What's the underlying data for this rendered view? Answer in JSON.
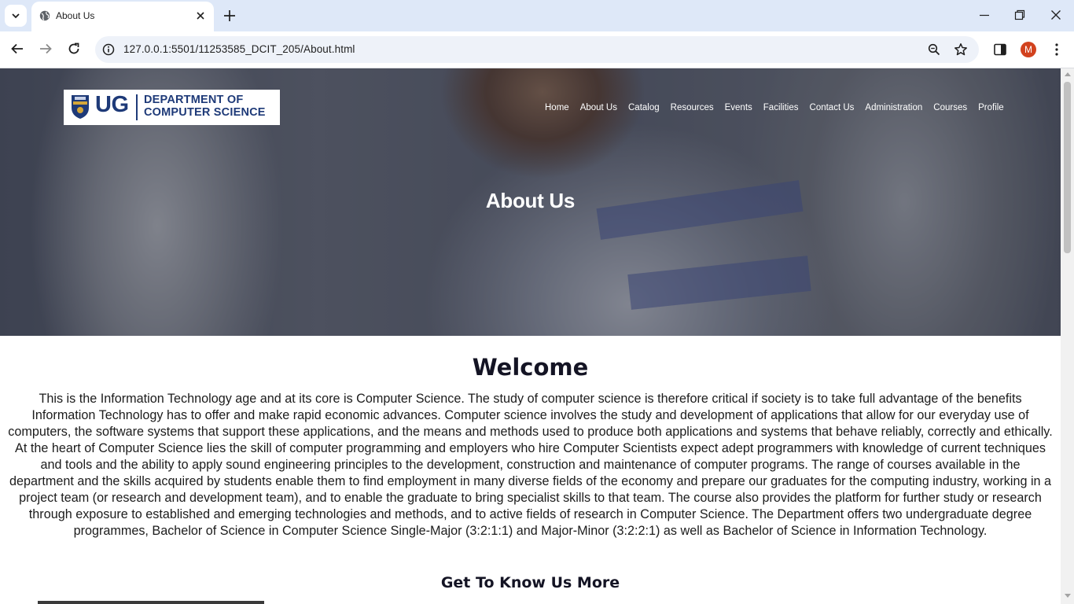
{
  "browser": {
    "tab_title": "About Us",
    "url": "127.0.0.1:5501/11253585_DCIT_205/About.html",
    "profile_initial": "M"
  },
  "site": {
    "logo": {
      "ug": "UG",
      "dept_line1": "DEPARTMENT OF",
      "dept_line2": "COMPUTER SCIENCE"
    },
    "nav": [
      "Home",
      "About Us",
      "Catalog",
      "Resources",
      "Events",
      "Facilities",
      "Contact Us",
      "Administration",
      "Courses",
      "Profile"
    ],
    "hero_title": "About Us"
  },
  "content": {
    "welcome_heading": "Welcome",
    "paragraph": "This is the Information Technology age and at its core is Computer Science. The study of computer science is therefore critical if society is to take full advantage of the benefits Information Technology has to offer and make rapid economic advances. Computer science involves the study and development of applications that allow for our everyday use of computers, the software systems that support these applications, and the means and methods used to produce both applications and systems that behave reliably, correctly and ethically. At the heart of Computer Science lies the skill of computer programming and employers who hire Computer Scientists expect adept programmers with knowledge of current techniques and tools and the ability to apply sound engineering principles to the development, construction and maintenance of computer programs. The range of courses available in the department and the skills acquired by students enable them to find employment in many diverse fields of the economy and prepare our graduates for the computing industry, working in a project team (or research and development team), and to enable the graduate to bring specialist skills to that team. The course also provides the platform for further study or research through exposure to established and emerging technologies and methods, and to active fields of research in Computer Science. The Department offers two undergraduate degree programmes, Bachelor of Science in Computer Science Single-Major (3:2:1:1) and Major-Minor (3:2:2:1) as well as Bachelor of Science in Information Technology.",
    "subheading": "Get To Know Us More"
  },
  "colors": {
    "tabbar": "#dee8f8",
    "logo_blue": "#1e3a78",
    "avatar": "#d2421e"
  }
}
